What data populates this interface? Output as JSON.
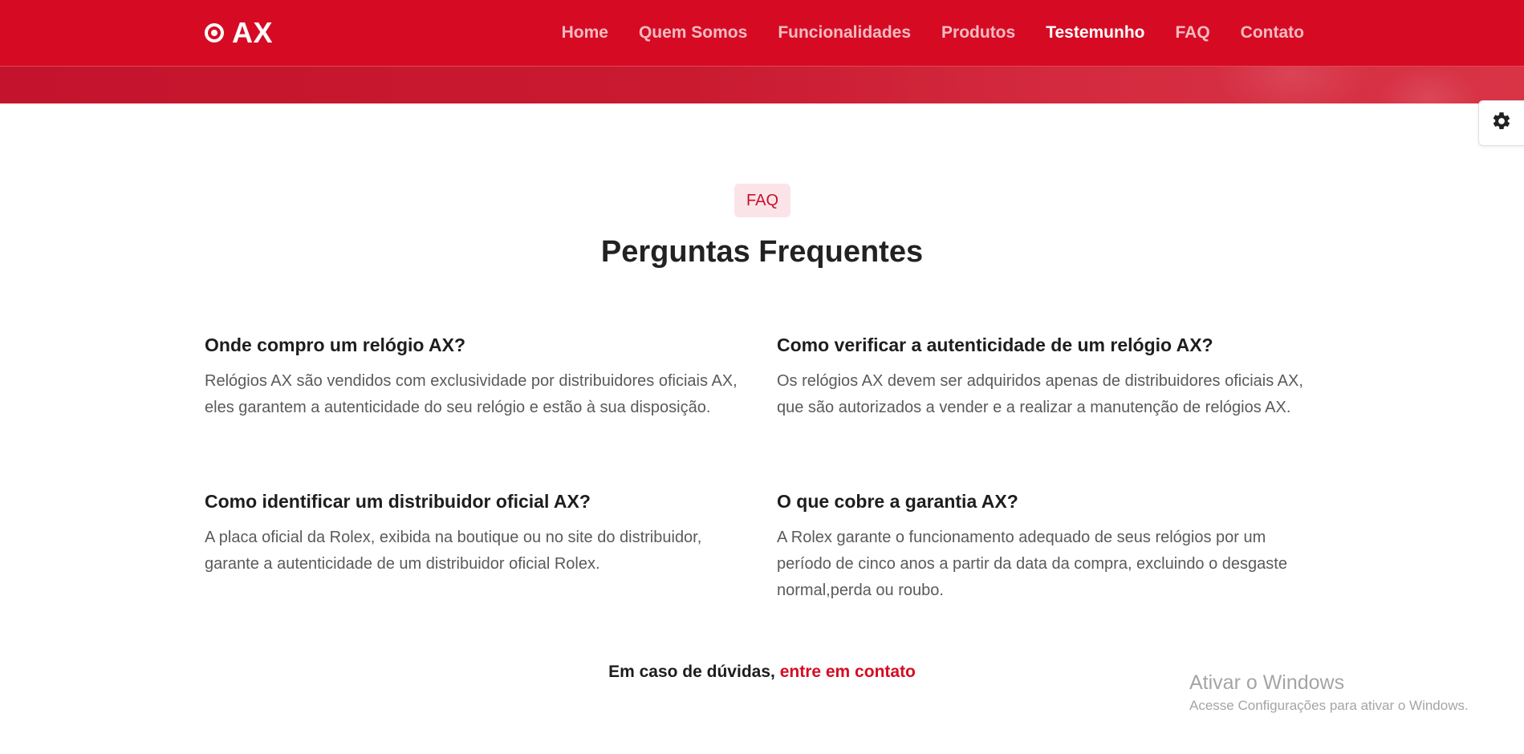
{
  "header": {
    "logo_text": "AX",
    "nav": [
      {
        "label": "Home"
      },
      {
        "label": "Quem Somos"
      },
      {
        "label": "Funcionalidades"
      },
      {
        "label": "Produtos"
      },
      {
        "label": "Testemunho"
      },
      {
        "label": "FAQ"
      },
      {
        "label": "Contato"
      }
    ],
    "active_nav": "Testemunho"
  },
  "colors": {
    "brand_red": "#d60b23",
    "badge_bg": "#fbe4e7"
  },
  "settings": {
    "icon": "gear-icon"
  },
  "faq": {
    "badge": "FAQ",
    "title": "Perguntas Frequentes",
    "items": [
      {
        "question": "Onde compro um relógio AX?",
        "answer": "Relógios AX são vendidos com exclusividade por distribuidores oficiais AX, eles garantem a autenticidade do seu relógio e estão à sua disposição."
      },
      {
        "question": "Como verificar a autenticidade de um relógio AX?",
        "answer": "Os relógios AX devem ser adquiridos apenas de distribuidores oficiais AX, que são autorizados a vender e a realizar a manutenção de relógios AX."
      },
      {
        "question": "Como identificar um distribuidor oficial AX?",
        "answer": "A placa oficial da Rolex, exibida na boutique ou no site do distribuidor, garante a autenticidade de um distribuidor oficial Rolex."
      },
      {
        "question": "O que cobre a garantia AX?",
        "answer": "A Rolex garante o funcionamento adequado de seus relógios por um período de cinco anos a partir da data da compra, excluindo o desgaste normal,perda ou roubo."
      }
    ],
    "contact_prefix": "Em caso de dúvidas,",
    "contact_link": "entre em contato"
  },
  "watermark": {
    "title": "Ativar o Windows",
    "subtitle": "Acesse Configurações para ativar o Windows."
  }
}
